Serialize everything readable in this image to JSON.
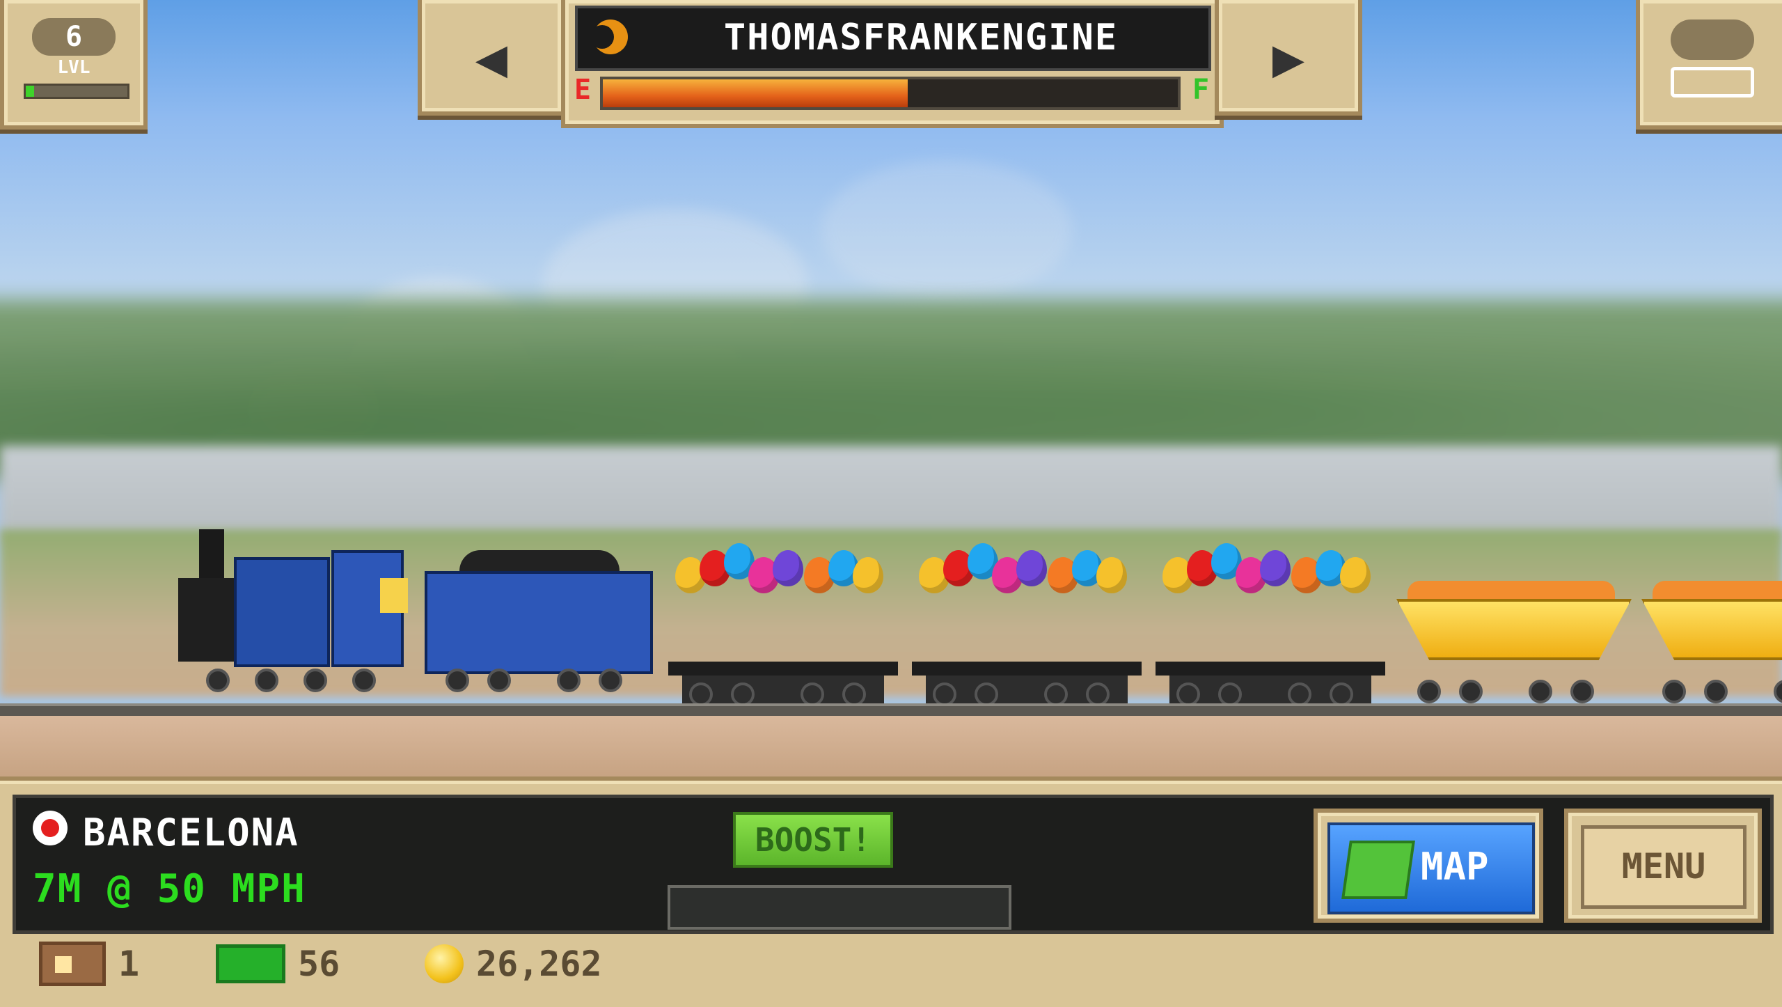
{
  "hud_top": {
    "level_number": "6",
    "level_label": "LVL",
    "level_progress": 0.08,
    "prev_arrow": "◀",
    "next_arrow": "▶",
    "train_name": "THOMASFRANKENGINE",
    "fuel_empty_label": "E",
    "fuel_full_label": "F",
    "fuel_level": 0.53
  },
  "hud_bottom": {
    "station_name": "BARCELONA",
    "distance_speed": "7M @ 50 MPH",
    "boost_label": "BOOST!",
    "boost_progress": 0,
    "map_label": "MAP",
    "menu_label": "MENU"
  },
  "footer": {
    "tickets": "1",
    "cash": "56",
    "coins": "26,262"
  },
  "colors": {
    "level_fill": "#3fd32a",
    "distance_text": "#2cdd1f",
    "boost_button": "#6cc734",
    "map_button": "#2f7ee8",
    "station_marker": "#e41f1f"
  },
  "icons": {
    "level": "cloud-badge-icon",
    "garage": "train-garage-icon",
    "ticket": "ticket-icon",
    "cash": "cash-icon",
    "coin": "coin-icon",
    "station": "station-marker-icon",
    "map": "map-icon",
    "engine_badge": "engine-badge-icon"
  }
}
